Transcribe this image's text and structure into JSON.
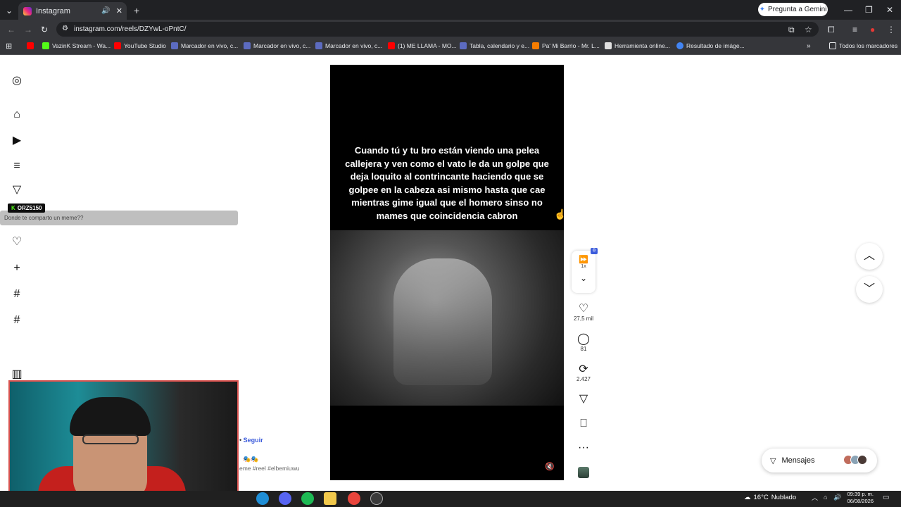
{
  "browser": {
    "tab_title": "Instagram",
    "url": "instagram.com/reels/DZYwL-oPntC/",
    "gemini_button": "Pregunta a Gemini",
    "bookmarks": [
      "VazinK Stream - Wa...",
      "YouTube Studio",
      "Marcador en vivo, c...",
      "Marcador en vivo, c...",
      "Marcador en vivo, c...",
      "(1) ME LLAMA - MO...",
      "Tabla, calendario y e...",
      "Pa' Mi Barrio - Mr. L...",
      "Herramienta online...",
      "Resultado de imáge...",
      "Todos los marcadores"
    ]
  },
  "overlay": {
    "username": "ORZ5150",
    "notification": "Donde te comparto un meme??"
  },
  "reel": {
    "caption": "Cuando tú y tu bro están viendo una pelea callejera y ven como el vato le da un golpe que deja loquito al contrincante haciendo que se golpee en la cabeza asi mismo  hasta que cae mientras gime igual que el homero sinso no mames que coincidencia cabron",
    "speed": "1x",
    "likes": "27,5 mil",
    "comments": "81",
    "reposts": "2.427",
    "follow": "Seguir",
    "hashtags": "eme #reel #elbemiuwu"
  },
  "messages": {
    "label": "Mensajes"
  },
  "taskbar": {
    "temperature": "16°C",
    "weather": "Nublado",
    "time": "09:39 p. m.",
    "date": "06/08/2026"
  }
}
